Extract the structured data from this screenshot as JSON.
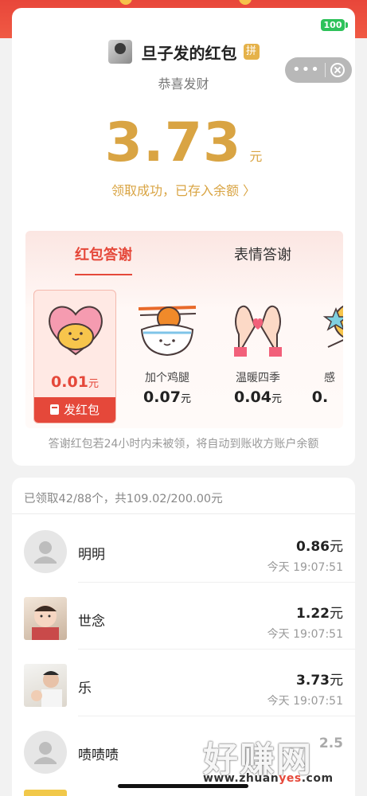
{
  "status_bar": {
    "battery": "100"
  },
  "sender": {
    "name": "旦子发的红包",
    "badge": "拼",
    "blessing": "恭喜发财"
  },
  "received": {
    "amount": "3.73",
    "unit": "元",
    "status_link": "领取成功，已存入余额 〉"
  },
  "thanks": {
    "tabs": [
      {
        "label": "红包答谢",
        "active": true
      },
      {
        "label": "表情答谢",
        "active": false
      }
    ],
    "gifts": [
      {
        "label": "",
        "price": "0.01",
        "unit": "元",
        "selected": true,
        "icon": "heart-hug-icon",
        "send_label": "发红包"
      },
      {
        "label": "加个鸡腿",
        "price": "0.07",
        "unit": "元",
        "selected": false,
        "icon": "rice-bowl-icon"
      },
      {
        "label": "温暖四季",
        "price": "0.04",
        "unit": "元",
        "selected": false,
        "icon": "heart-hands-icon"
      },
      {
        "label": "感",
        "price": "0.",
        "unit": "",
        "selected": false,
        "icon": "star-icon"
      }
    ],
    "notice": "答谢红包若24小时内未被领，将自动到账收方账户余额"
  },
  "claims": {
    "summary": "已领取42/88个，共109.02/200.00元",
    "rows": [
      {
        "name": "明明",
        "amount": "0.86",
        "unit": "元",
        "time": "今天 19:07:51",
        "avatar": "default-avatar-icon"
      },
      {
        "name": "世念",
        "amount": "1.22",
        "unit": "元",
        "time": "今天 19:07:51",
        "avatar": "baby-photo-avatar"
      },
      {
        "name": "乐",
        "amount": "3.73",
        "unit": "元",
        "time": "今天 19:07:51",
        "avatar": "photo-avatar"
      },
      {
        "name": "啧啧啧",
        "amount": "2.5",
        "unit": "",
        "time": "",
        "avatar": "default-avatar-icon"
      }
    ]
  },
  "watermark": {
    "text": "好赚网",
    "url_prefix": "www.zhuan",
    "url_highlight": "yes",
    "url_suffix": ".com"
  },
  "colors": {
    "accent_red": "#e5483a",
    "gold": "#d9a443"
  }
}
